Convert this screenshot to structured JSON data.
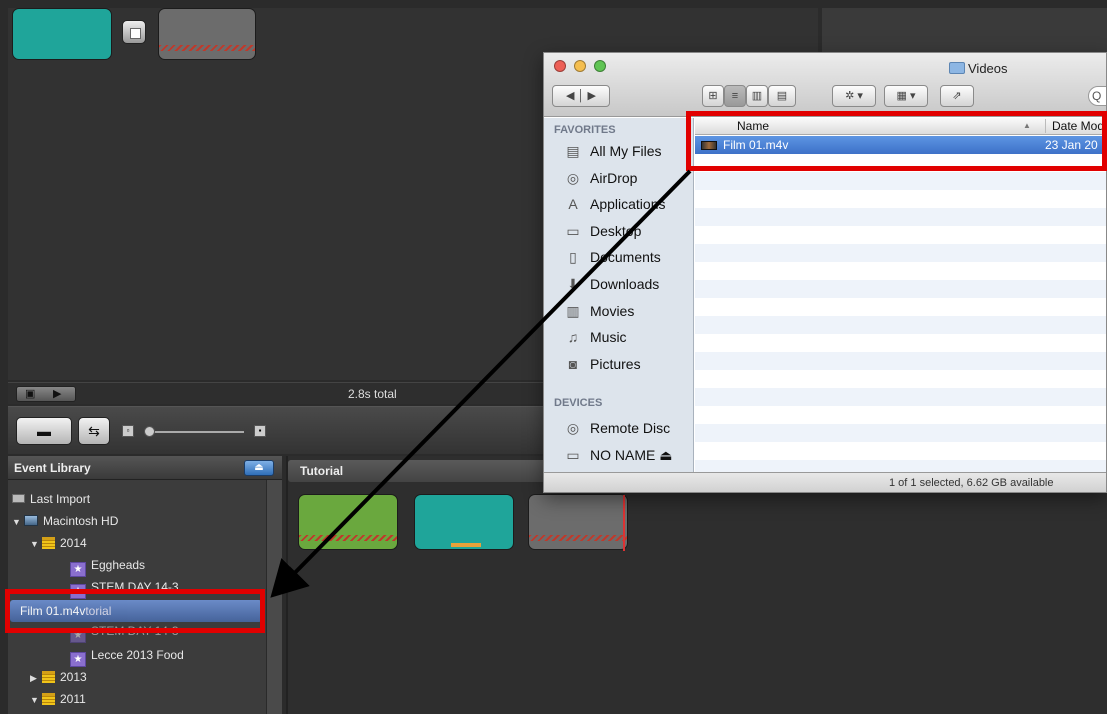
{
  "project": {
    "total_label": "2.8s total"
  },
  "event_library": {
    "header": "Event Library",
    "eject_label": "⏏",
    "items": [
      {
        "label": "Last Import"
      },
      {
        "label": "Macintosh HD"
      },
      {
        "label": "2014"
      },
      {
        "label": "Eggheads"
      },
      {
        "label": "STEM DAY 14-3"
      },
      {
        "label": "torial"
      },
      {
        "label": "STEM DAY 14-3"
      },
      {
        "label": "Lecce 2013 Food"
      },
      {
        "label": "2013"
      },
      {
        "label": "2011"
      }
    ]
  },
  "drag": {
    "label": "Film 01.m4v"
  },
  "tutorial": {
    "header": "Tutorial"
  },
  "finder": {
    "title": "Videos",
    "search_glyph": "Q",
    "favorites_header": "FAVORITES",
    "devices_header": "DEVICES",
    "favorites": [
      {
        "label": "All My Files",
        "icon": "all-files-icon",
        "glyph": "▤"
      },
      {
        "label": "AirDrop",
        "icon": "airdrop-icon",
        "glyph": "◎"
      },
      {
        "label": "Applications",
        "icon": "applications-icon",
        "glyph": "A"
      },
      {
        "label": "Desktop",
        "icon": "desktop-icon",
        "glyph": "▭"
      },
      {
        "label": "Documents",
        "icon": "documents-icon",
        "glyph": "▯"
      },
      {
        "label": "Downloads",
        "icon": "downloads-icon",
        "glyph": "⬇"
      },
      {
        "label": "Movies",
        "icon": "movies-icon",
        "glyph": "▥"
      },
      {
        "label": "Music",
        "icon": "music-icon",
        "glyph": "♫"
      },
      {
        "label": "Pictures",
        "icon": "pictures-icon",
        "glyph": "◙"
      }
    ],
    "devices": [
      {
        "label": "Remote Disc",
        "icon": "remote-disc-icon",
        "glyph": "◎"
      },
      {
        "label": "NO NAME ⏏",
        "icon": "drive-icon",
        "glyph": "▭"
      }
    ],
    "columns": {
      "name": "Name",
      "date": "Date Mod"
    },
    "files": [
      {
        "name": "Film 01.m4v",
        "date": "23 Jan 20",
        "selected": true
      }
    ],
    "status": "1 of 1 selected, 6.62 GB available"
  },
  "colors": {
    "highlight_red": "#e10000",
    "selection_blue": "#3d71c8",
    "arrow": "#000000"
  }
}
